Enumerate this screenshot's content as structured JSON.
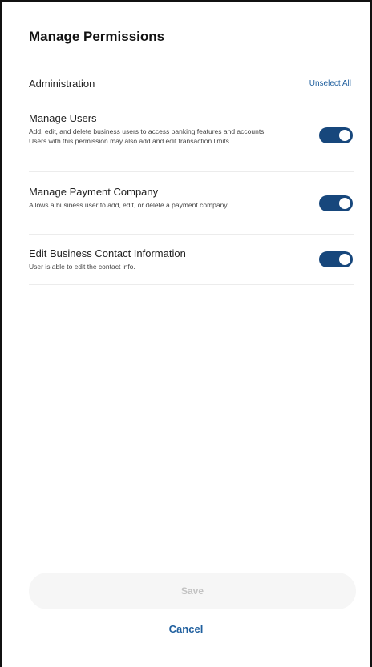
{
  "header": {
    "title": "Manage Permissions"
  },
  "section": {
    "title": "Administration",
    "unselect_all_label": "Unselect All"
  },
  "permissions": [
    {
      "title": "Manage Users",
      "description": "Add, edit, and delete business users to access banking features and accounts. Users with this permission may also add and edit transaction limits.",
      "enabled": true
    },
    {
      "title": "Manage Payment Company",
      "description": "Allows a business user to add, edit, or delete a payment company.",
      "enabled": true
    },
    {
      "title": "Edit Business Contact Information",
      "description": "User is able to edit the contact info.",
      "enabled": true
    }
  ],
  "actions": {
    "save_label": "Save",
    "cancel_label": "Cancel"
  },
  "colors": {
    "accent": "#17477c",
    "link": "#1f5f9e"
  }
}
